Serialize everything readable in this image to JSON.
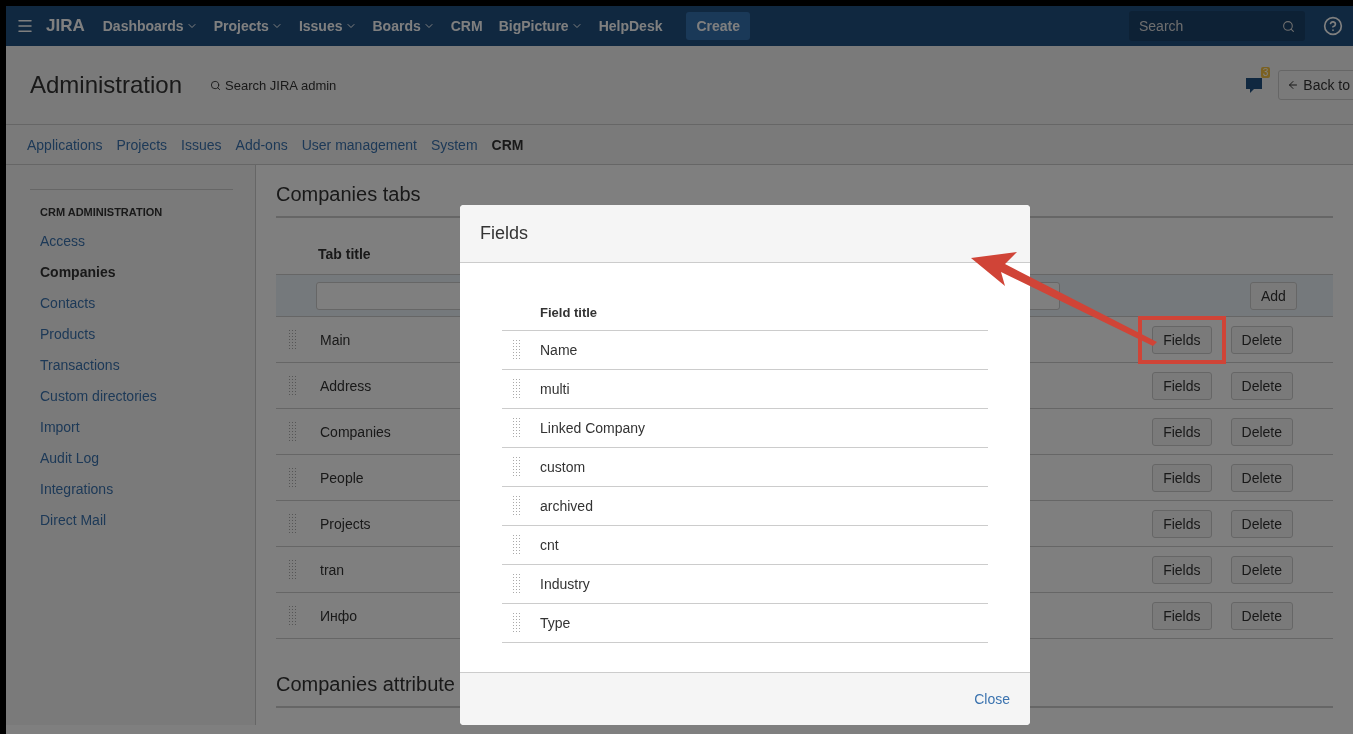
{
  "nav": {
    "logo": "JIRA",
    "menu": [
      {
        "label": "Dashboards",
        "dropdown": true
      },
      {
        "label": "Projects",
        "dropdown": true
      },
      {
        "label": "Issues",
        "dropdown": true
      },
      {
        "label": "Boards",
        "dropdown": true
      },
      {
        "label": "CRM",
        "dropdown": false
      },
      {
        "label": "BigPicture",
        "dropdown": true
      },
      {
        "label": "HelpDesk",
        "dropdown": false
      }
    ],
    "create": "Create",
    "search": {
      "placeholder": "Search"
    }
  },
  "header": {
    "title": "Administration",
    "search": {
      "placeholder": "Search JIRA admin"
    },
    "notifications": "3",
    "back": "Back to"
  },
  "tabs": [
    {
      "label": "Applications",
      "selected": false
    },
    {
      "label": "Projects",
      "selected": false
    },
    {
      "label": "Issues",
      "selected": false
    },
    {
      "label": "Add-ons",
      "selected": false
    },
    {
      "label": "User management",
      "selected": false
    },
    {
      "label": "System",
      "selected": false
    },
    {
      "label": "CRM",
      "selected": true
    }
  ],
  "sidebar": {
    "heading": "CRM ADMINISTRATION",
    "items": [
      {
        "label": "Access",
        "selected": false
      },
      {
        "label": "Companies",
        "selected": true
      },
      {
        "label": "Contacts",
        "selected": false
      },
      {
        "label": "Products",
        "selected": false
      },
      {
        "label": "Transactions",
        "selected": false
      },
      {
        "label": "Custom directories",
        "selected": false
      },
      {
        "label": "Import",
        "selected": false
      },
      {
        "label": "Audit Log",
        "selected": false
      },
      {
        "label": "Integrations",
        "selected": false
      },
      {
        "label": "Direct Mail",
        "selected": false
      }
    ]
  },
  "section": {
    "title": "Companies tabs",
    "column": "Tab title",
    "add": "Add",
    "rows": [
      {
        "title": "Main",
        "fields": "Fields",
        "delete": "Delete",
        "highlighted": true
      },
      {
        "title": "Address",
        "fields": "Fields",
        "delete": "Delete",
        "highlighted": false
      },
      {
        "title": "Companies",
        "fields": "Fields",
        "delete": "Delete",
        "highlighted": false
      },
      {
        "title": "People",
        "fields": "Fields",
        "delete": "Delete",
        "highlighted": false
      },
      {
        "title": "Projects",
        "fields": "Fields",
        "delete": "Delete",
        "highlighted": false
      },
      {
        "title": "tran",
        "fields": "Fields",
        "delete": "Delete",
        "highlighted": false
      },
      {
        "title": "Инфо",
        "fields": "Fields",
        "delete": "Delete",
        "highlighted": false
      }
    ]
  },
  "section2": {
    "title": "Companies attribute"
  },
  "dialog": {
    "title": "Fields",
    "column": "Field title",
    "fields": [
      "Name",
      "multi",
      "Linked Company",
      "custom",
      "archived",
      "cnt",
      "Industry",
      "Type"
    ],
    "close": "Close"
  }
}
